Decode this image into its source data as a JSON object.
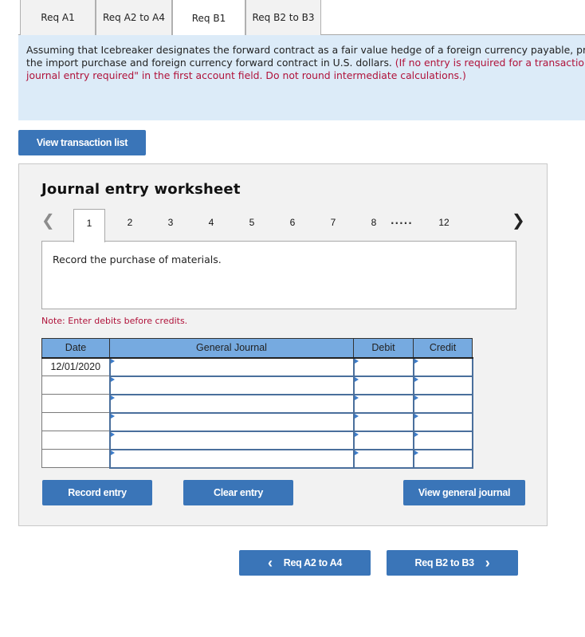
{
  "tabs": [
    {
      "label": "Req A1",
      "active": false
    },
    {
      "label": "Req A2 to A4",
      "active": false
    },
    {
      "label": "Req B1",
      "active": true
    },
    {
      "label": "Req B2 to B3",
      "active": false
    }
  ],
  "instructions": {
    "text": "Assuming that Icebreaker designates the forward contract as a fair value hedge of a foreign currency payable, prepare journal entries for",
    "text_line2": "the import purchase and foreign currency forward contract in U.S. dollars.",
    "note": "(If no entry is required for a transaction/event, select \"No",
    "note_line3": "journal entry required\" in the first account field. Do not round intermediate calculations.)"
  },
  "view_transaction_list_label": "View transaction list",
  "worksheet": {
    "title": "Journal entry worksheet",
    "pager": {
      "prev_icon": "chevron-left-icon",
      "next_icon": "chevron-right-icon",
      "pages": [
        "1",
        "2",
        "3",
        "4",
        "5",
        "6",
        "7",
        "8"
      ],
      "ellipsis": ".....",
      "last_page": "12",
      "current_page": "1"
    },
    "description": "Record the purchase of materials.",
    "note": "Note: Enter debits before credits.",
    "table": {
      "headers": {
        "date": "Date",
        "account": "General Journal",
        "debit": "Debit",
        "credit": "Credit"
      },
      "rows": [
        {
          "date": "12/01/2020",
          "account": "",
          "debit": "",
          "credit": ""
        },
        {
          "date": "",
          "account": "",
          "debit": "",
          "credit": ""
        },
        {
          "date": "",
          "account": "",
          "debit": "",
          "credit": ""
        },
        {
          "date": "",
          "account": "",
          "debit": "",
          "credit": ""
        },
        {
          "date": "",
          "account": "",
          "debit": "",
          "credit": ""
        },
        {
          "date": "",
          "account": "",
          "debit": "",
          "credit": ""
        }
      ]
    },
    "buttons": {
      "record": "Record entry",
      "clear": "Clear entry",
      "view_journal": "View general journal"
    }
  },
  "nav": {
    "prev_label": "Req A2 to A4",
    "next_label": "Req B2 to B3",
    "prev_icon": "‹",
    "next_icon": "›"
  },
  "colors": {
    "button_blue": "#3a75b8",
    "panel_blue": "#dcebf8",
    "header_blue": "#76aae0",
    "note_red": "#b0123a"
  }
}
